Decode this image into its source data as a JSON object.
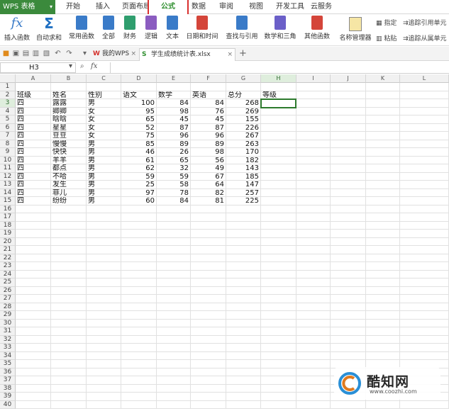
{
  "app": {
    "title": "WPS 表格"
  },
  "menu_tabs": [
    "开始",
    "插入",
    "页面布局",
    "公式",
    "数据",
    "审阅",
    "视图",
    "开发工具",
    "云服务"
  ],
  "ribbon": {
    "insert_function": "插入函数",
    "autosum": "自动求和",
    "common_functions": "常用函数",
    "all": "全部",
    "finance": "财务",
    "logic": "逻辑",
    "text": "文本",
    "datetime": "日期和时间",
    "lookup": "查找与引用",
    "math": "数学和三角",
    "other": "其他函数",
    "name_manager": "名称管理器",
    "paste": "粘贴",
    "specify": "指定",
    "trace_precedents": "追踪引用单元",
    "trace_dependents": "追踪从属单元"
  },
  "tabs": {
    "home": "我的WPS",
    "file": "学生成绩统计表.xlsx"
  },
  "formula_bar": {
    "name_box": "H3",
    "fx": "fx"
  },
  "columns": [
    "A",
    "B",
    "C",
    "D",
    "E",
    "F",
    "G",
    "H",
    "I",
    "J",
    "K",
    "L"
  ],
  "rows": [
    [
      "班级",
      "姓名",
      "性别",
      "语文",
      "数学",
      "英语",
      "总分",
      "等级"
    ],
    [
      "四",
      "露露",
      "男",
      "100",
      "84",
      "84",
      "268",
      ""
    ],
    [
      "四",
      "卿卿",
      "女",
      "95",
      "98",
      "76",
      "269",
      ""
    ],
    [
      "四",
      "晗晗",
      "女",
      "65",
      "45",
      "45",
      "155",
      ""
    ],
    [
      "四",
      "星星",
      "女",
      "52",
      "87",
      "87",
      "226",
      ""
    ],
    [
      "四",
      "豆豆",
      "女",
      "75",
      "96",
      "96",
      "267",
      ""
    ],
    [
      "四",
      "慢慢",
      "男",
      "85",
      "89",
      "89",
      "263",
      ""
    ],
    [
      "四",
      "快快",
      "男",
      "46",
      "26",
      "98",
      "170",
      ""
    ],
    [
      "四",
      "羊羊",
      "男",
      "61",
      "65",
      "56",
      "182",
      ""
    ],
    [
      "四",
      "都点",
      "男",
      "62",
      "32",
      "49",
      "143",
      ""
    ],
    [
      "四",
      "不哈",
      "男",
      "59",
      "59",
      "67",
      "185",
      ""
    ],
    [
      "四",
      "发生",
      "男",
      "25",
      "58",
      "64",
      "147",
      ""
    ],
    [
      "四",
      "菲儿",
      "男",
      "97",
      "78",
      "82",
      "257",
      ""
    ],
    [
      "四",
      "纷纷",
      "男",
      "60",
      "84",
      "81",
      "225",
      ""
    ]
  ],
  "watermark": {
    "title": "酷知网",
    "url": "www.coozhi.com"
  },
  "colors": {
    "accent": "#3b8a3c",
    "highlight_box": "#d9302f"
  }
}
